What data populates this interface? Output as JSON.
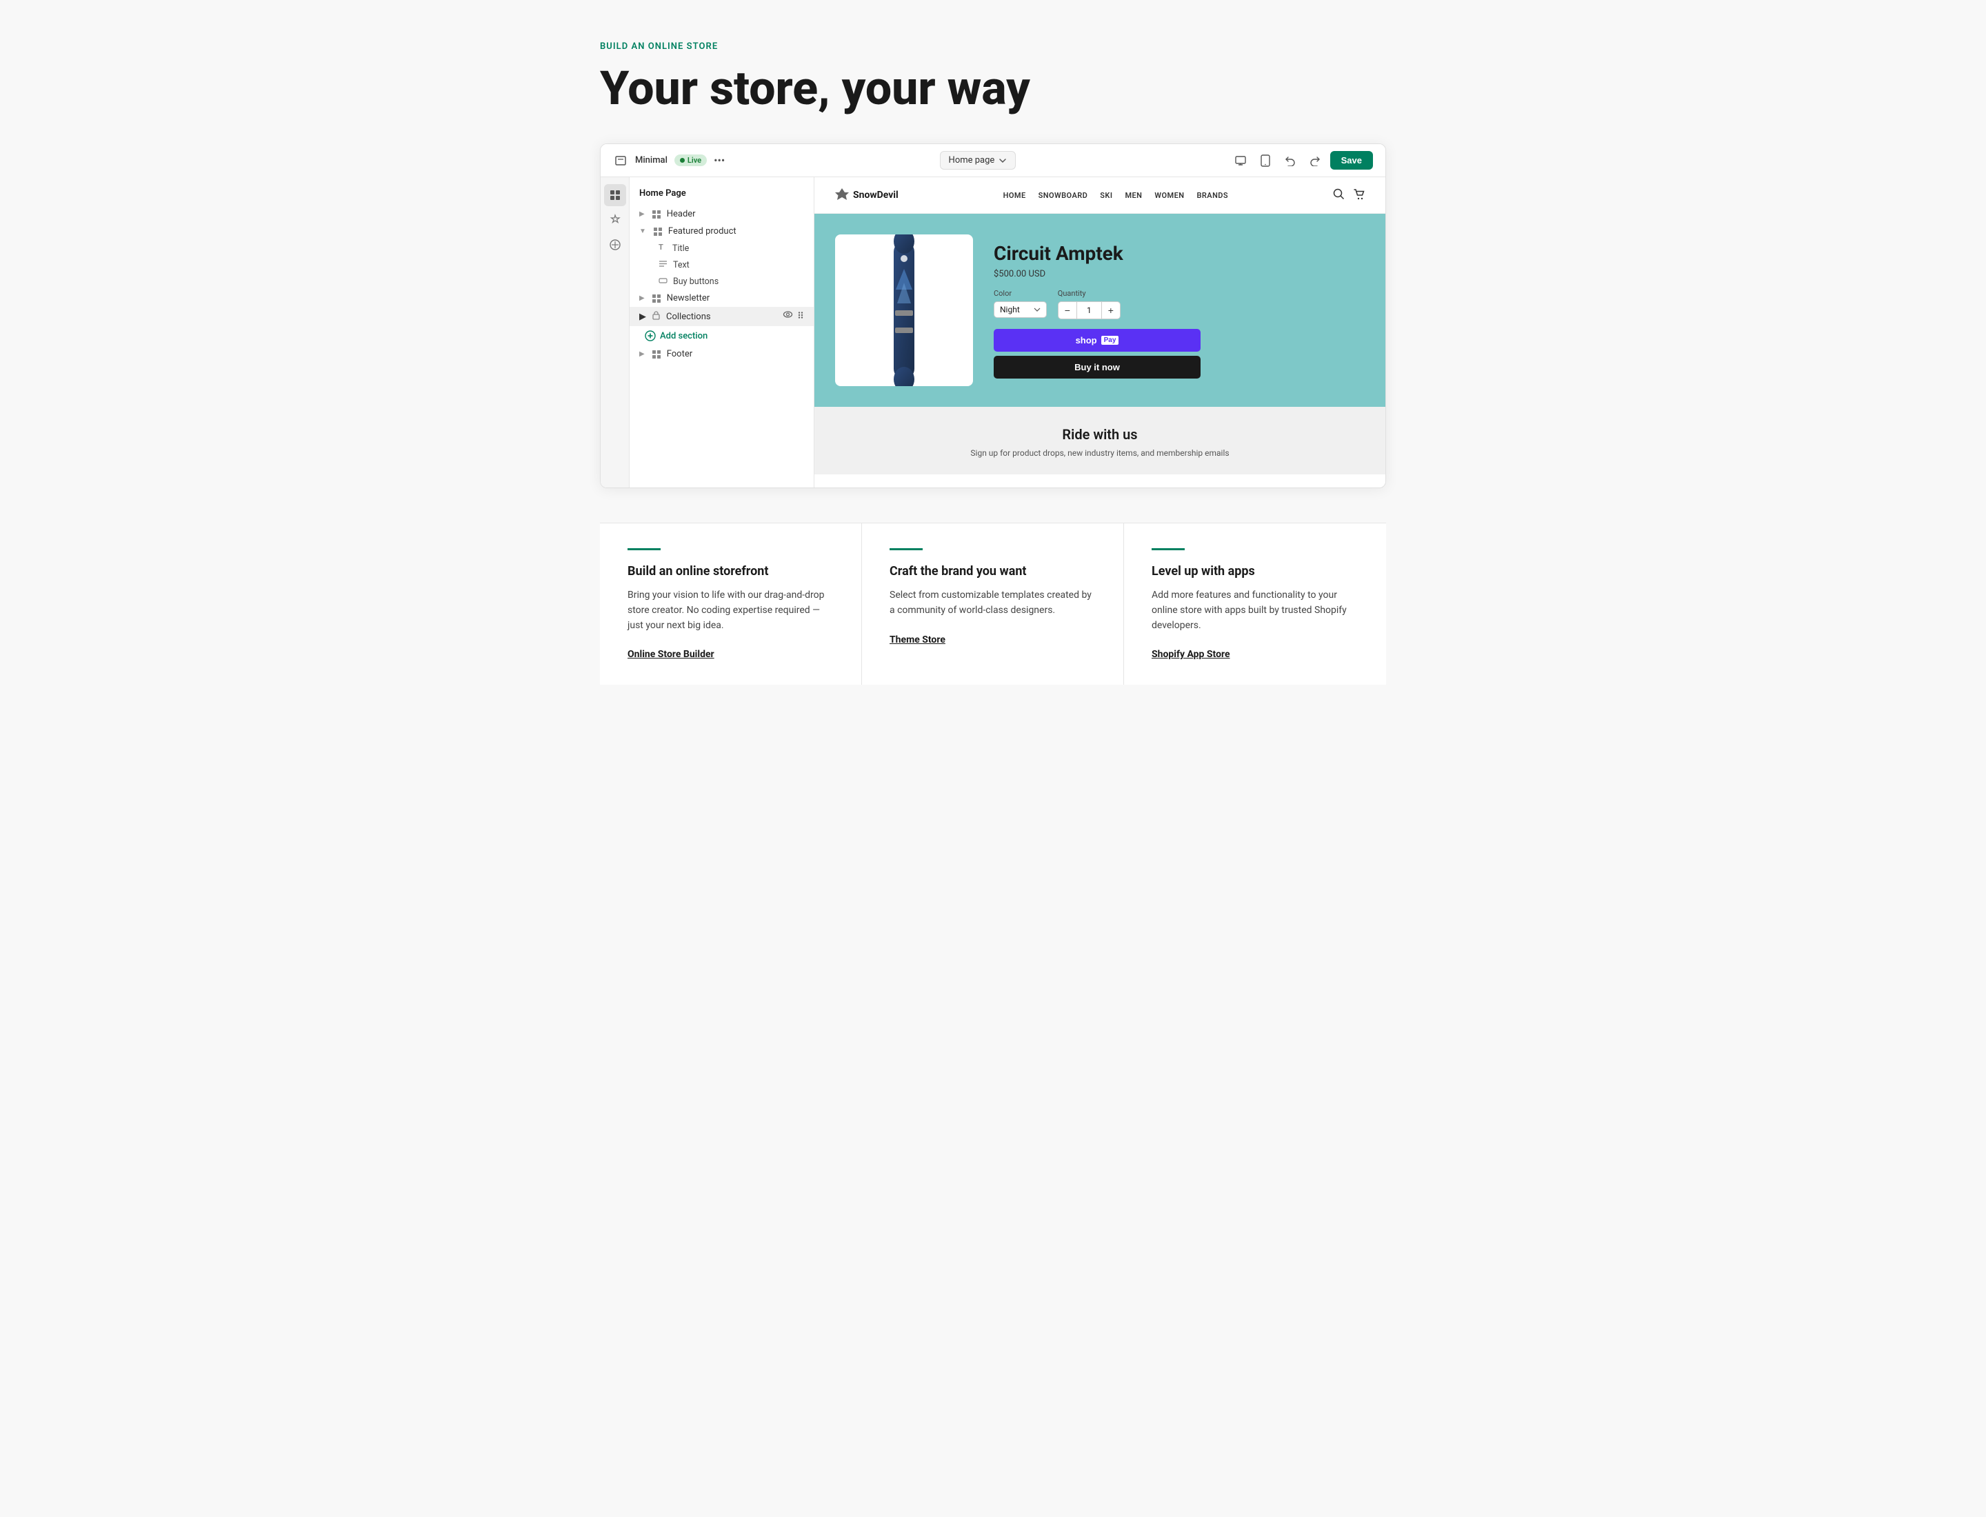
{
  "page": {
    "build_label": "BUILD AN ONLINE STORE",
    "headline": "Your store, your way"
  },
  "editor": {
    "theme_name": "Minimal",
    "live_badge": "Live",
    "dots": "•••",
    "page_selector": "Home page",
    "save_button": "Save"
  },
  "sidebar": {
    "section_title": "Home Page",
    "items": [
      {
        "label": "Header",
        "type": "grid"
      },
      {
        "label": "Featured product",
        "type": "grid",
        "expandable": true
      },
      {
        "label": "Title",
        "type": "text",
        "sub": true
      },
      {
        "label": "Text",
        "type": "text",
        "sub": true
      },
      {
        "label": "Buy buttons",
        "type": "image",
        "sub": true
      },
      {
        "label": "Newsletter",
        "type": "grid"
      },
      {
        "label": "Collections",
        "type": "lock",
        "active": true
      },
      {
        "label": "Add section",
        "type": "add"
      },
      {
        "label": "Footer",
        "type": "grid"
      }
    ]
  },
  "store": {
    "logo": "SnowDevil",
    "nav_items": [
      "HOME",
      "SNOWBOARD",
      "SKI",
      "MEN",
      "WOMEN",
      "BRANDS"
    ],
    "product": {
      "name": "Circuit Amptek",
      "price": "$500.00 USD",
      "color_label": "Color",
      "color_value": "Night",
      "qty_label": "Quantity",
      "qty_value": "1",
      "shop_pay_label": "shop Pay",
      "buy_now_label": "Buy it now"
    },
    "newsletter": {
      "title": "Ride with us",
      "subtitle": "Sign up for product drops, new industry items, and membership emails"
    }
  },
  "cards": [
    {
      "title": "Build an online storefront",
      "desc": "Bring your vision to life with our drag-and-drop store creator. No coding expertise required — just your next big idea.",
      "link": "Online Store Builder"
    },
    {
      "title": "Craft the brand you want",
      "desc": "Select from customizable templates created by a community of world-class designers.",
      "link": "Theme Store"
    },
    {
      "title": "Level up with apps",
      "desc": "Add more features and functionality to your online store with apps built by trusted Shopify developers.",
      "link": "Shopify App Store"
    }
  ]
}
